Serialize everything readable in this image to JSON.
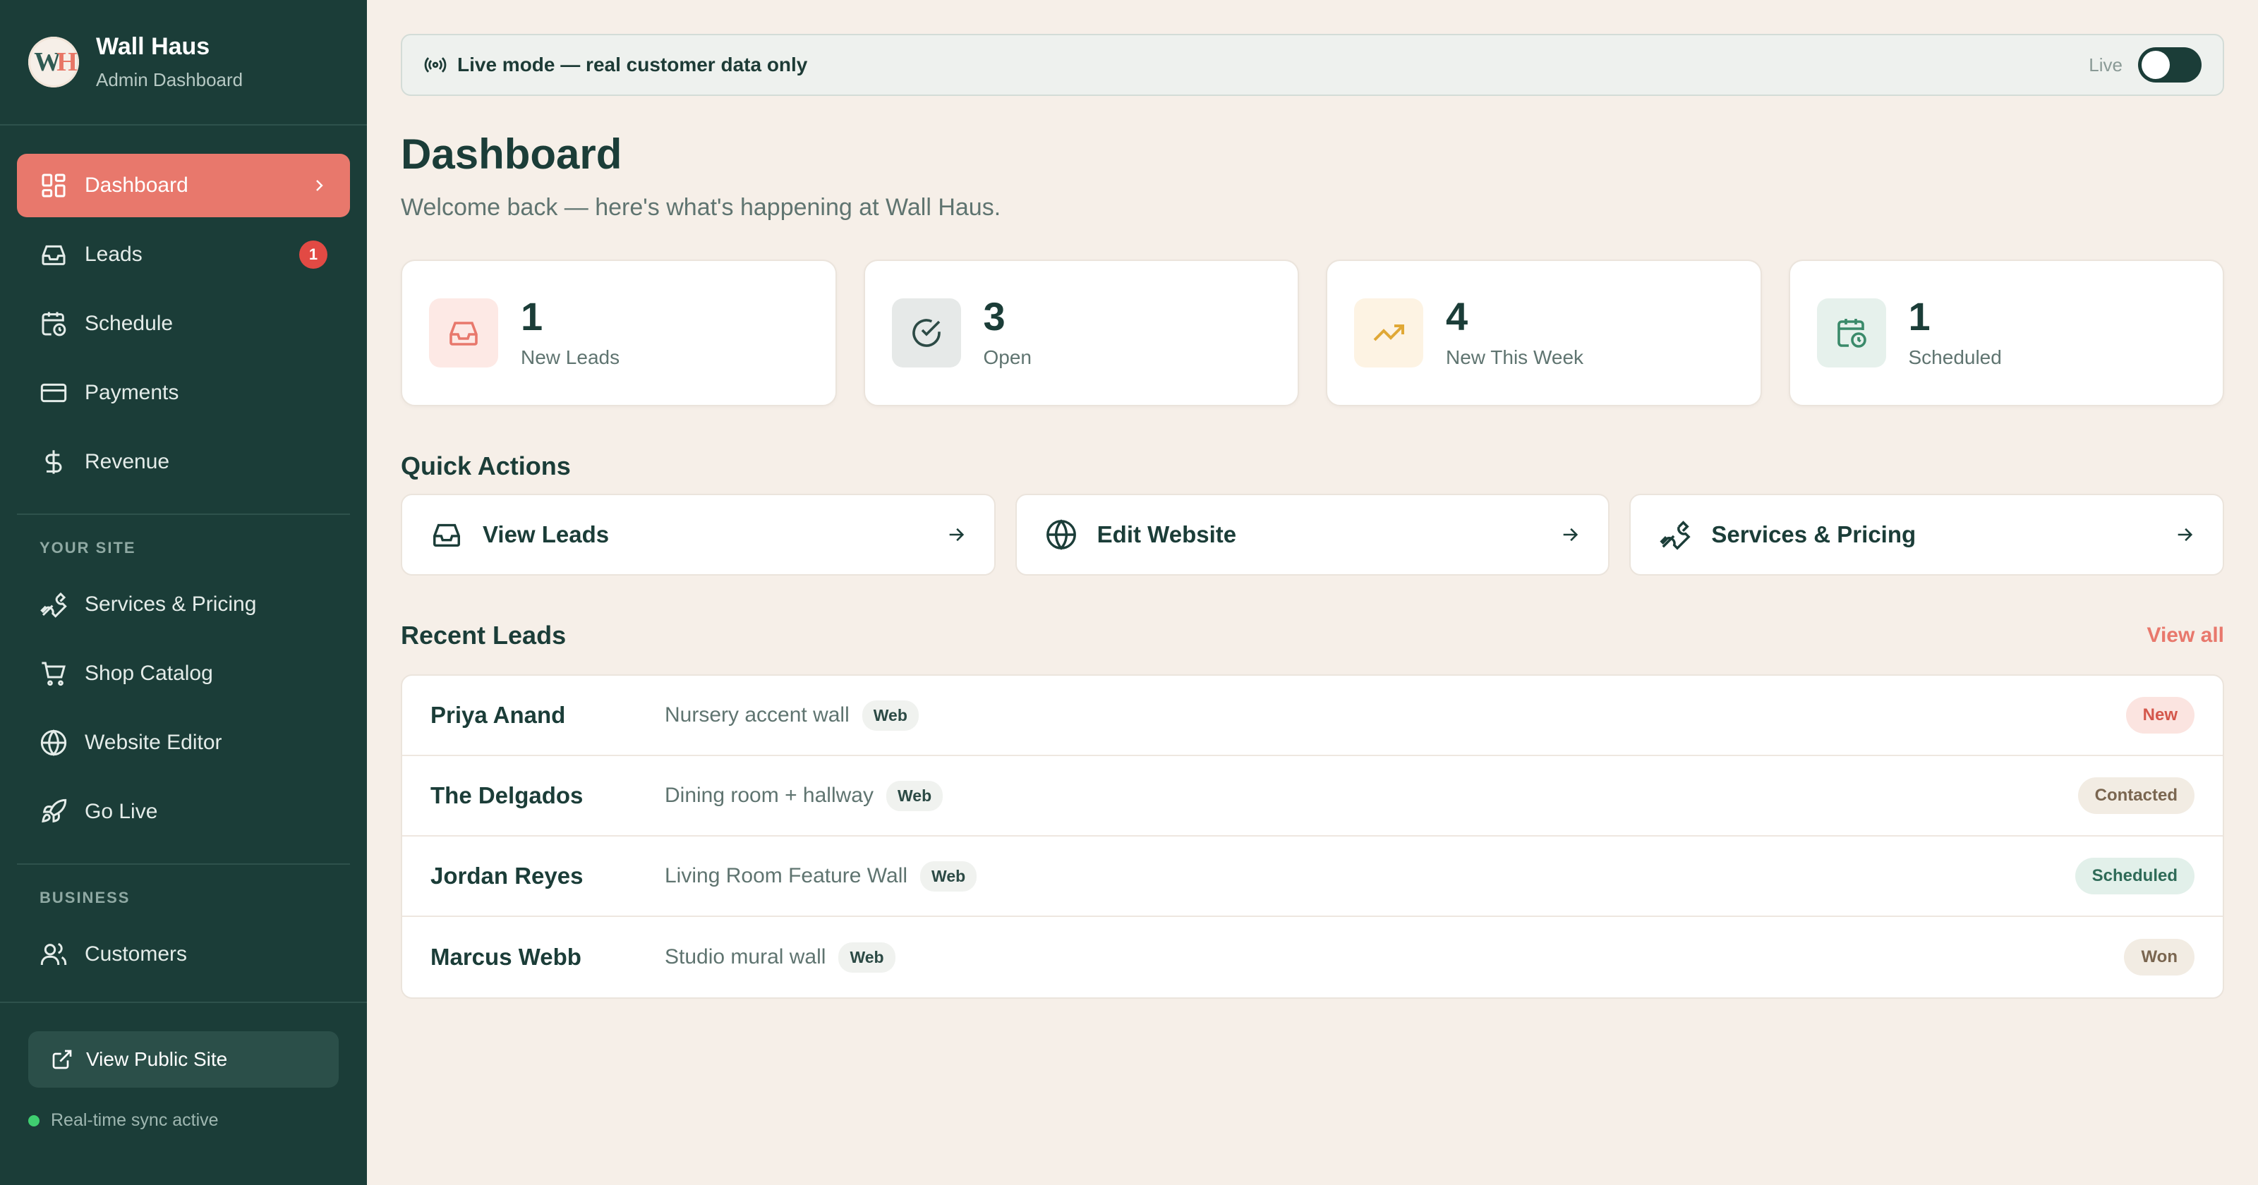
{
  "brand": {
    "logo_letters": "WH",
    "name": "Wall Haus",
    "subtitle": "Admin Dashboard"
  },
  "nav": {
    "main": [
      {
        "label": "Dashboard",
        "icon": "dashboard-icon",
        "active": true
      },
      {
        "label": "Leads",
        "icon": "inbox-icon",
        "badge": "1"
      },
      {
        "label": "Schedule",
        "icon": "calendar-clock-icon"
      },
      {
        "label": "Payments",
        "icon": "credit-card-icon"
      },
      {
        "label": "Revenue",
        "icon": "dollar-icon"
      }
    ],
    "your_site_heading": "YOUR SITE",
    "your_site": [
      {
        "label": "Services & Pricing",
        "icon": "wrench-icon"
      },
      {
        "label": "Shop Catalog",
        "icon": "cart-icon"
      },
      {
        "label": "Website Editor",
        "icon": "globe-icon"
      },
      {
        "label": "Go Live",
        "icon": "rocket-icon"
      }
    ],
    "business_heading": "BUSINESS",
    "business": [
      {
        "label": "Customers",
        "icon": "users-icon"
      }
    ]
  },
  "footer": {
    "public_site_label": "View Public Site",
    "sync_status": "Real-time sync active"
  },
  "live_banner": {
    "text": "Live mode — real customer data only",
    "toggle_label": "Live",
    "toggle_on": true
  },
  "page": {
    "title": "Dashboard",
    "subtitle": "Welcome back — here's what's happening at Wall Haus."
  },
  "stats": [
    {
      "value": "1",
      "label": "New Leads",
      "icon": "inbox-icon",
      "color": "#e8786c"
    },
    {
      "value": "3",
      "label": "Open",
      "icon": "check-circle-icon",
      "color": "#2c4a45"
    },
    {
      "value": "4",
      "label": "New This Week",
      "icon": "trending-up-icon",
      "color": "#e0a836"
    },
    {
      "value": "1",
      "label": "Scheduled",
      "icon": "calendar-clock-icon",
      "color": "#3a8a6a"
    }
  ],
  "quick_actions": {
    "title": "Quick Actions",
    "items": [
      {
        "label": "View Leads",
        "icon": "inbox-icon"
      },
      {
        "label": "Edit Website",
        "icon": "globe-icon"
      },
      {
        "label": "Services & Pricing",
        "icon": "wrench-icon"
      }
    ]
  },
  "recent_leads": {
    "title": "Recent Leads",
    "view_all": "View all",
    "rows": [
      {
        "name": "Priya Anand",
        "desc": "Nursery accent wall",
        "source": "Web",
        "status": "New"
      },
      {
        "name": "The Delgados",
        "desc": "Dining room + hallway",
        "source": "Web",
        "status": "Contacted"
      },
      {
        "name": "Jordan Reyes",
        "desc": "Living Room Feature Wall",
        "source": "Web",
        "status": "Scheduled"
      },
      {
        "name": "Marcus Webb",
        "desc": "Studio mural wall",
        "source": "Web",
        "status": "Won"
      }
    ]
  },
  "colors": {
    "sidebar": "#1b3d38",
    "accent": "#e8786c",
    "background": "#f6efe8"
  }
}
